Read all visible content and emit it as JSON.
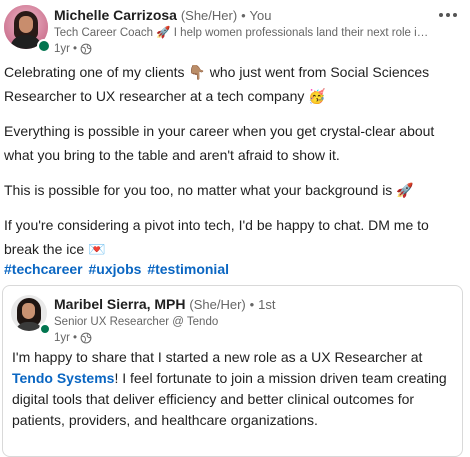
{
  "author": {
    "name": "Michelle Carrizosa",
    "pronouns": "(She/Her)",
    "separator": "•",
    "relation": "You",
    "headline": "Tech Career Coach 🚀 I help women professionals land their next role in…",
    "time": "1yr",
    "time_separator": "•",
    "visibility_icon": "globe-icon"
  },
  "post": {
    "paragraphs": [
      "Celebrating one of my clients 👇🏽 who just went from Social Sciences Researcher to UX researcher at a tech company 🥳",
      "Everything is possible in your career when you get crystal-clear about what you bring to the table and aren't afraid to show it.",
      "This is possible for you too, no matter what your background is 🚀",
      "If you're considering a pivot into tech, I'd be happy to chat. DM me to break the ice 💌"
    ],
    "hashtags": [
      "#techcareer",
      "#uxjobs",
      "#testimonial"
    ]
  },
  "shared_post": {
    "author_name": "Maribel Sierra, MPH",
    "pronouns": "(She/Her)",
    "separator": "•",
    "degree": "1st",
    "headline": "Senior UX Researcher @ Tendo",
    "time": "1yr",
    "time_separator": "•",
    "text_before": "I'm happy to share that I started a new role as a UX Researcher at ",
    "company": "Tendo Systems",
    "text_after": "! I feel fortunate to join a mission driven team creating digital tools that deliver efficiency and better clinical outcomes for patients, providers, and healthcare organizations."
  },
  "colors": {
    "link": "#0a66c2",
    "online": "#01754f",
    "secondary_text": "#666666"
  }
}
